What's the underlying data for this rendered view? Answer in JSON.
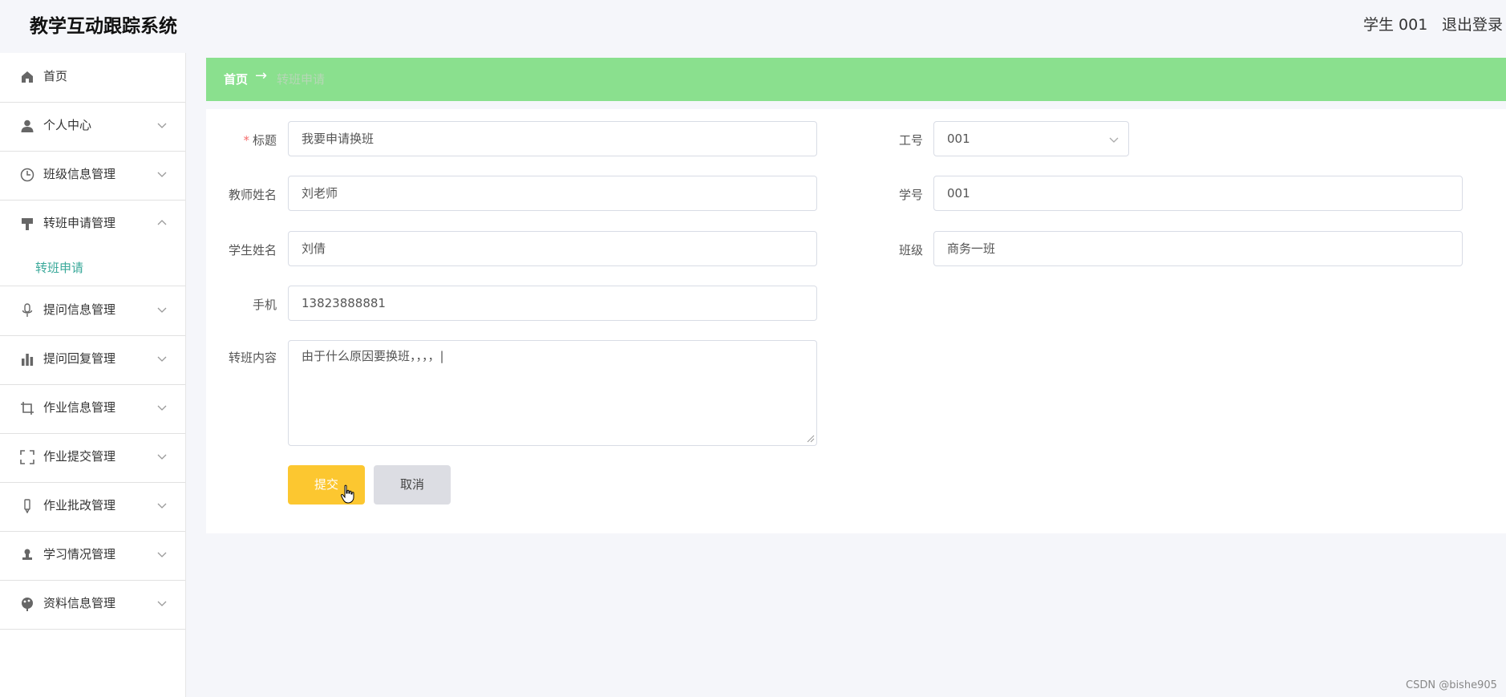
{
  "app": {
    "title": "教学互动跟踪系统"
  },
  "header": {
    "user": "学生 001",
    "logout": "退出登录"
  },
  "sidebar": {
    "items": [
      {
        "label": "首页",
        "icon": "home-icon"
      },
      {
        "label": "个人中心",
        "icon": "user-icon"
      },
      {
        "label": "班级信息管理",
        "icon": "clock-icon"
      },
      {
        "label": "转班申请管理",
        "icon": "brush-icon",
        "expanded": true
      },
      {
        "label": "提问信息管理",
        "icon": "microphone-icon"
      },
      {
        "label": "提问回复管理",
        "icon": "bar-chart-icon"
      },
      {
        "label": "作业信息管理",
        "icon": "crop-icon"
      },
      {
        "label": "作业提交管理",
        "icon": "fullscreen-icon"
      },
      {
        "label": "作业批改管理",
        "icon": "pen-icon"
      },
      {
        "label": "学习情况管理",
        "icon": "person-stamp-icon"
      },
      {
        "label": "资料信息管理",
        "icon": "paint-icon"
      }
    ],
    "submenu": {
      "label": "转班申请"
    }
  },
  "breadcrumb": {
    "home": "首页",
    "separator": "→",
    "current": "转班申请"
  },
  "form": {
    "title": {
      "label": "标题",
      "required": "*",
      "value": "我要申请换班"
    },
    "teacher_id": {
      "label": "工号",
      "value": "001"
    },
    "teacher_name": {
      "label": "教师姓名",
      "value": "刘老师"
    },
    "student_id": {
      "label": "学号",
      "value": "001"
    },
    "student_name": {
      "label": "学生姓名",
      "value": "刘倩"
    },
    "class": {
      "label": "班级",
      "value": "商务一班"
    },
    "phone": {
      "label": "手机",
      "value": "13823888881"
    },
    "content": {
      "label": "转班内容",
      "value": "由于什么原因要换班，，，，|"
    },
    "submit": "提交",
    "cancel": "取消"
  },
  "watermark": "CSDN @bishe905",
  "colors": {
    "accent_green": "#8ae08e",
    "submit_yellow": "#fcc730",
    "active_teal": "#3aa99a"
  }
}
